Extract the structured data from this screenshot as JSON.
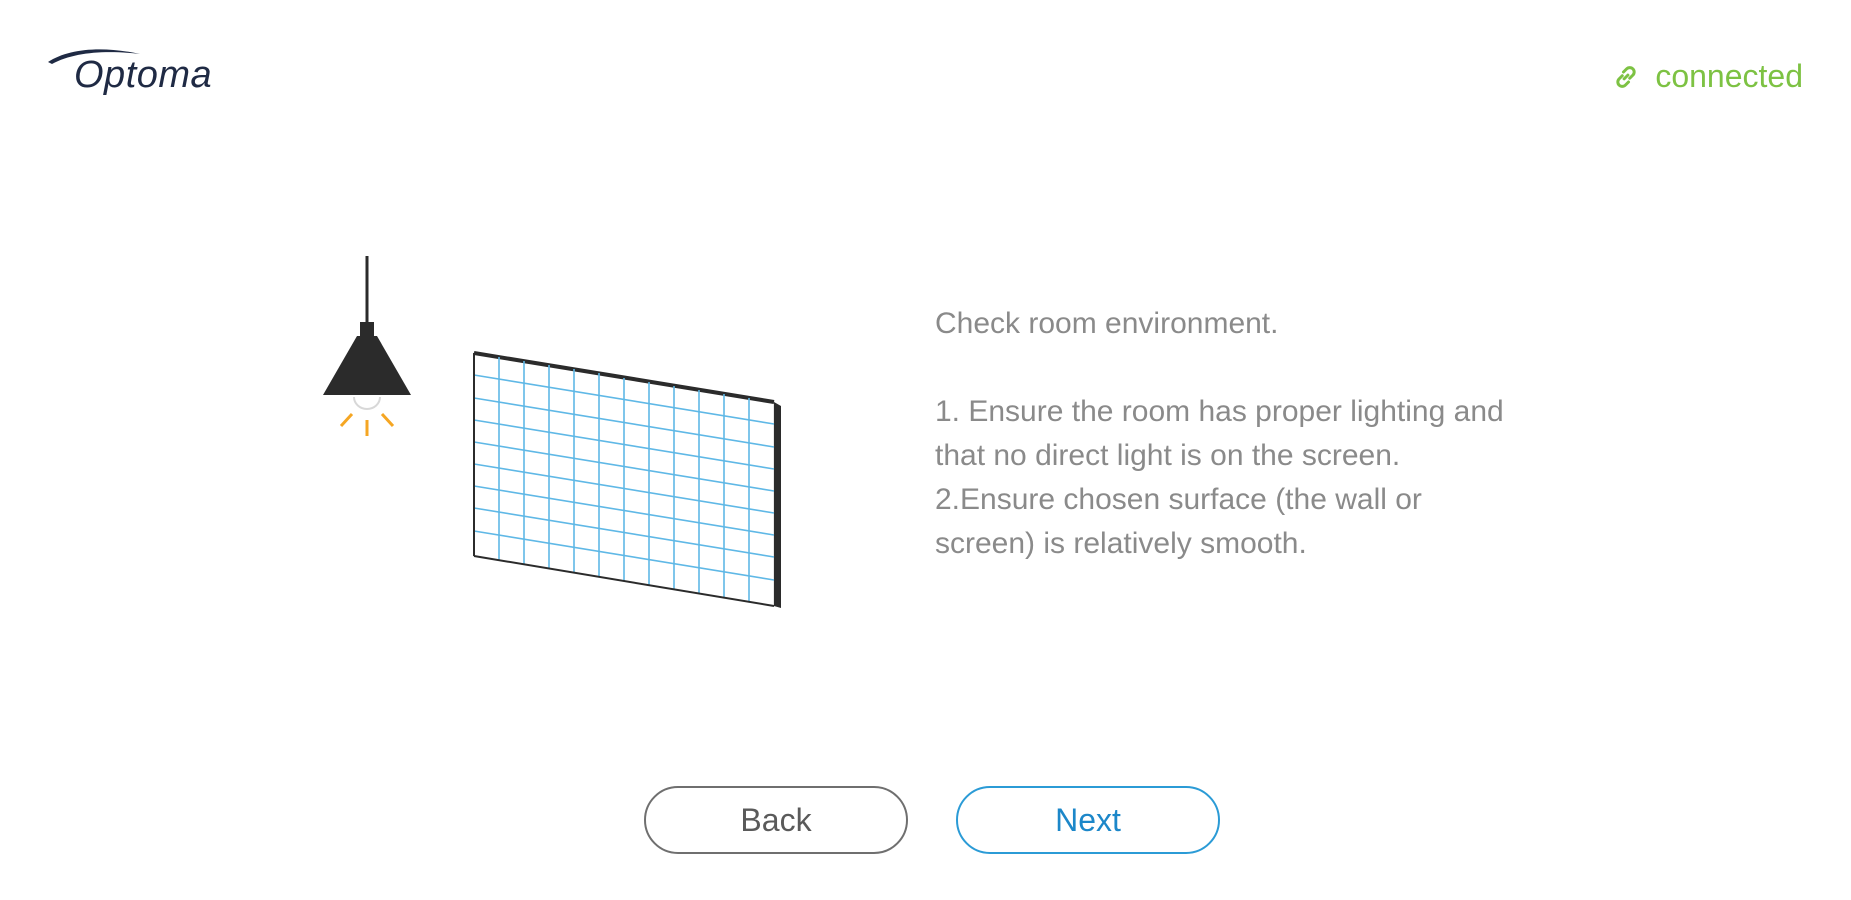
{
  "header": {
    "logo_text": "Optoma",
    "status_text": "connected",
    "status_icon": "link-icon"
  },
  "main": {
    "illustration_icons": [
      "ceiling-lamp-icon",
      "projection-screen-icon"
    ],
    "instructions": {
      "heading": "Check room environment.",
      "line1": "1. Ensure the room has proper lighting and",
      "line2": "that no direct light is on the screen.",
      "line3": "2.Ensure chosen surface (the wall or",
      "line4": "screen) is relatively smooth."
    }
  },
  "footer": {
    "back_label": "Back",
    "next_label": "Next"
  },
  "colors": {
    "brand_navy": "#1f2a44",
    "connected_green": "#7dc243",
    "accent_blue": "#2b9bd6",
    "text_gray": "#8a8a8a",
    "lamp_glow": "#f5a623"
  }
}
